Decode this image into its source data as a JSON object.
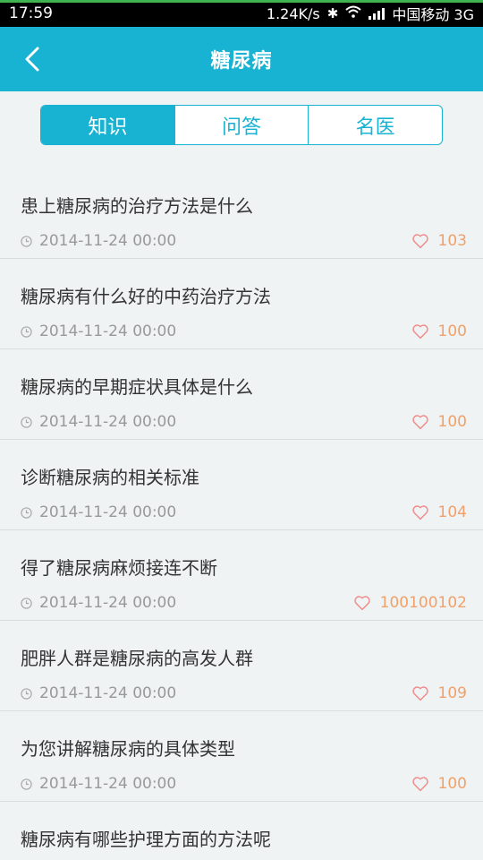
{
  "status_bar": {
    "time": "17:59",
    "speed": "1.24K/s",
    "carrier": "中国移动 3G"
  },
  "header": {
    "title": "糖尿病"
  },
  "tabs": [
    {
      "label": "知识",
      "active": true
    },
    {
      "label": "问答",
      "active": false
    },
    {
      "label": "名医",
      "active": false
    }
  ],
  "articles": [
    {
      "title": "患上糖尿病的治疗方法是什么",
      "date": "2014-11-24 00:00",
      "likes": "103"
    },
    {
      "title": "糖尿病有什么好的中药治疗方法",
      "date": "2014-11-24 00:00",
      "likes": "100"
    },
    {
      "title": "糖尿病的早期症状具体是什么",
      "date": "2014-11-24 00:00",
      "likes": "100"
    },
    {
      "title": "诊断糖尿病的相关标准",
      "date": "2014-11-24 00:00",
      "likes": "104"
    },
    {
      "title": "得了糖尿病麻烦接连不断",
      "date": "2014-11-24 00:00",
      "likes": "100100102"
    },
    {
      "title": "肥胖人群是糖尿病的高发人群",
      "date": "2014-11-24 00:00",
      "likes": "109"
    },
    {
      "title": "为您讲解糖尿病的具体类型",
      "date": "2014-11-24 00:00",
      "likes": "100"
    },
    {
      "title": "糖尿病有哪些护理方面的方法呢",
      "date": "",
      "likes": ""
    }
  ],
  "colors": {
    "primary": "#18b3d2",
    "like": "#f0a16b",
    "background": "#eff3f3"
  }
}
